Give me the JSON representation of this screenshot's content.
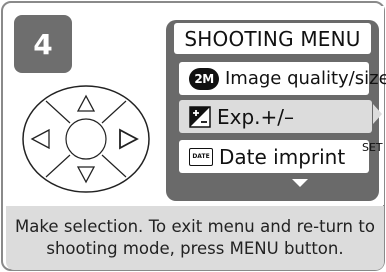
{
  "step": "4",
  "menu": {
    "title": "SHOOTING MENU",
    "items": [
      {
        "icon": "image-size-icon",
        "icon_text": "2M",
        "label": "Image quality/size"
      },
      {
        "icon": "exposure-compensation-icon",
        "label": "Exp.+/–",
        "selected": true
      },
      {
        "icon": "date-imprint-icon",
        "icon_text": "DATE",
        "label": "Date imprint"
      }
    ],
    "set_label": "SET",
    "right_indicator": "right-triangle-icon",
    "more_indicator": "down-triangle-icon"
  },
  "multi_selector": {
    "buttons": [
      "up",
      "left",
      "right",
      "down"
    ],
    "highlighted": "right"
  },
  "caption": "Make selection.  To exit menu and re-turn to shooting mode, press MENU button.",
  "colors": {
    "panel": "#6a6a6a",
    "badge": "#6e6e6e",
    "caption_bg": "#dcdcdc",
    "selected_item": "#dcdcdc"
  }
}
